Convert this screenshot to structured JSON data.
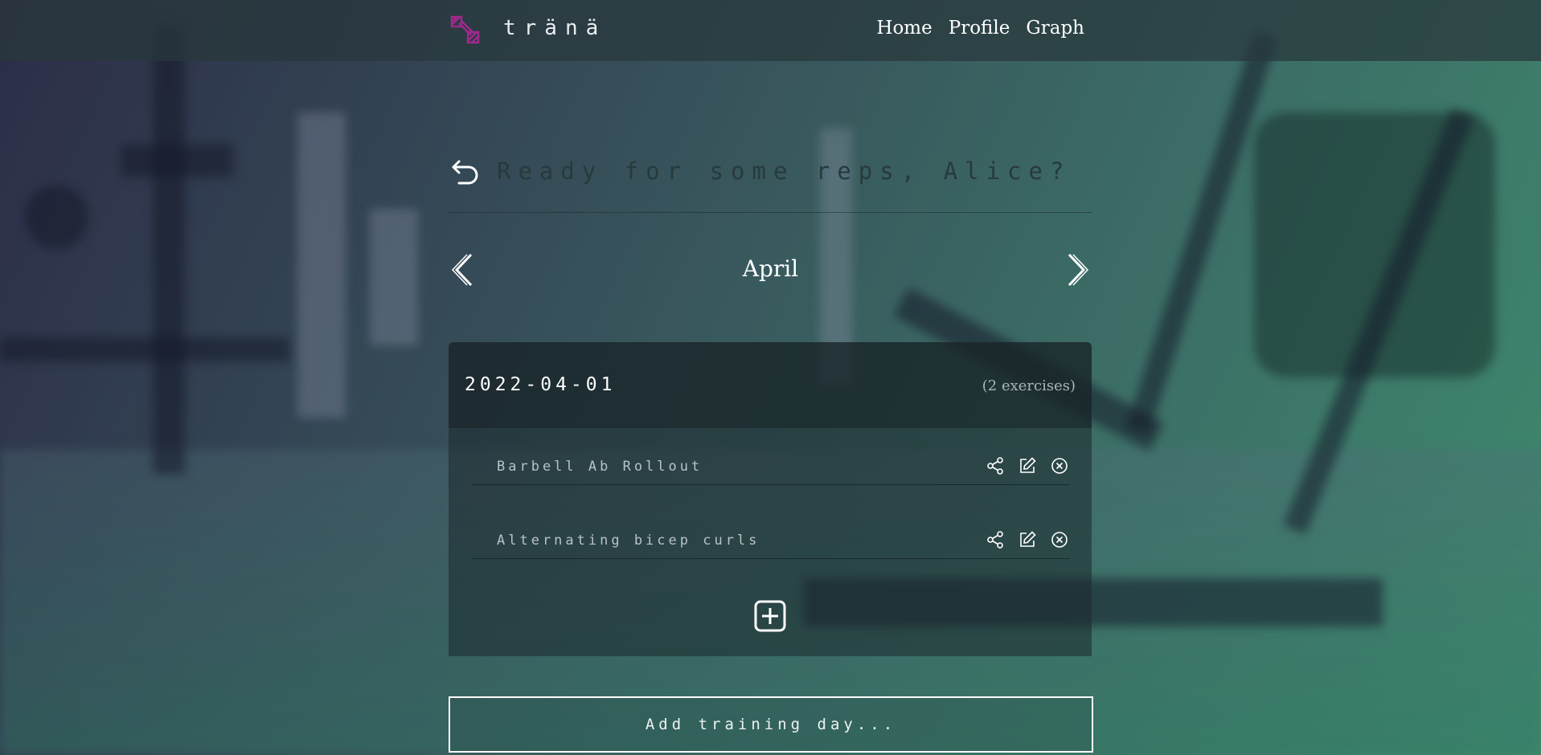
{
  "brand": {
    "name": "tränä",
    "logo_icon": "dumbbell-icon",
    "logo_color": "#a3288f"
  },
  "nav": {
    "links": [
      "Home",
      "Profile",
      "Graph"
    ]
  },
  "header": {
    "greeting": "Ready for some reps, Alice?",
    "back_icon": "undo-arrow-icon"
  },
  "month_selector": {
    "month": "April",
    "prev_icon": "chevron-left-icon",
    "next_icon": "chevron-right-icon"
  },
  "training_day": {
    "date": "2022-04-01",
    "exercise_count": "(2 exercises)",
    "exercises": [
      {
        "name": "Barbell Ab Rollout",
        "actions": [
          "share-icon",
          "edit-icon",
          "delete-icon"
        ]
      },
      {
        "name": "Alternating bicep curls",
        "actions": [
          "share-icon",
          "edit-icon",
          "delete-icon"
        ]
      }
    ],
    "add_exercise_icon": "plus-square-icon"
  },
  "add_day": {
    "label": "Add training day..."
  },
  "colors": {
    "accent": "#a3288f",
    "text": "#ffffff",
    "muted": "#b7c3c4"
  }
}
